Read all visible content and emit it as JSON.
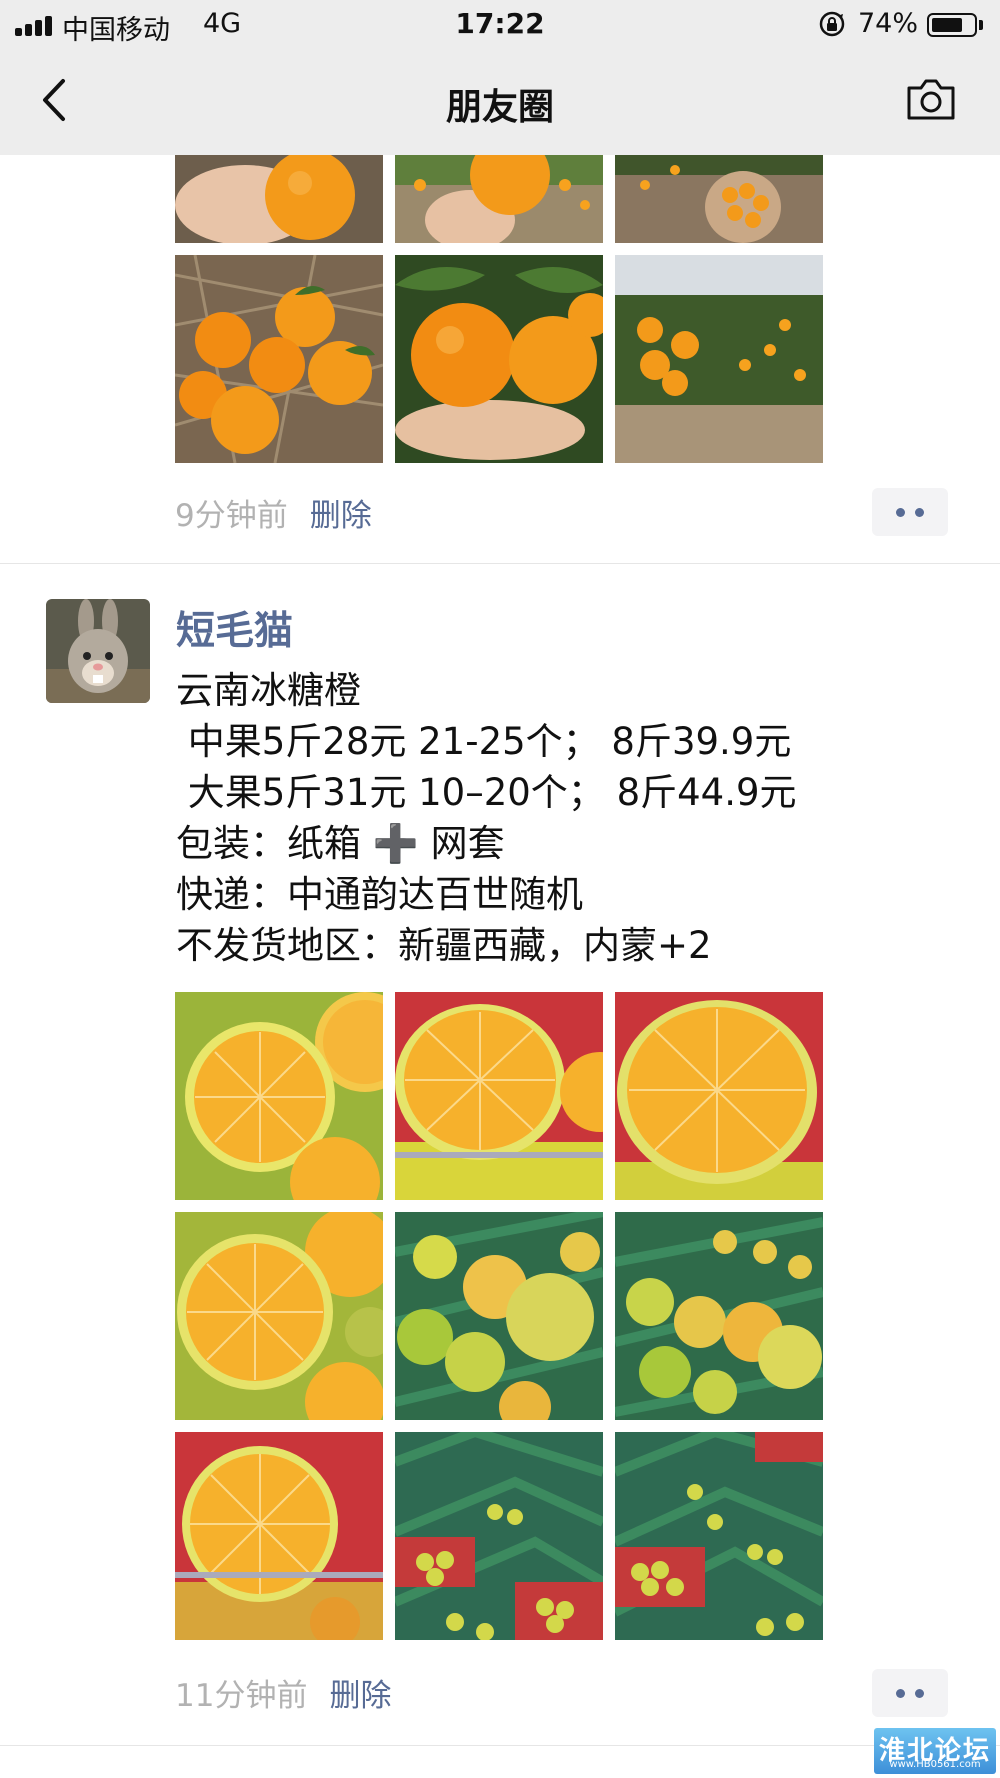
{
  "status_bar": {
    "carrier": "中国移动",
    "network": "4G",
    "time": "17:22",
    "battery": "74%",
    "battery_level": 0.74
  },
  "nav": {
    "back_icon": "chevron-left-icon",
    "title": "朋友圈",
    "camera_icon": "camera-icon"
  },
  "post1": {
    "time_ago": "9分钟前",
    "delete_label": "删除",
    "photos": [
      "orange-in-hand",
      "orange-held-over-bushes",
      "basket-of-oranges",
      "oranges-on-straw",
      "oranges-on-branch-in-hand",
      "orange-orchard"
    ]
  },
  "post2": {
    "author": "短毛猫",
    "lines": [
      "云南冰糖橙",
      " 中果5斤28元 21-25个； 8斤39.9元",
      " 大果5斤31元 10–20个； 8斤44.9元",
      "包装：纸箱 ➕ 网套",
      "快递：中通韵达百世随机",
      "不发货地区：新疆西藏，内蒙+2"
    ],
    "time_ago": "11分钟前",
    "delete_label": "删除",
    "photos": [
      "cut-oranges-1",
      "half-orange-1",
      "half-orange-2",
      "cut-oranges-2",
      "crates-of-oranges-1",
      "crates-of-oranges-2",
      "half-orange-3",
      "crates-of-oranges-3",
      "crates-of-oranges-4"
    ]
  },
  "watermark": {
    "text": "淮北论坛",
    "url": "www.HB0561.com"
  },
  "colors": {
    "link": "#576b95",
    "timestamp": "#b2b2b2",
    "nav_bg": "#ededed"
  }
}
